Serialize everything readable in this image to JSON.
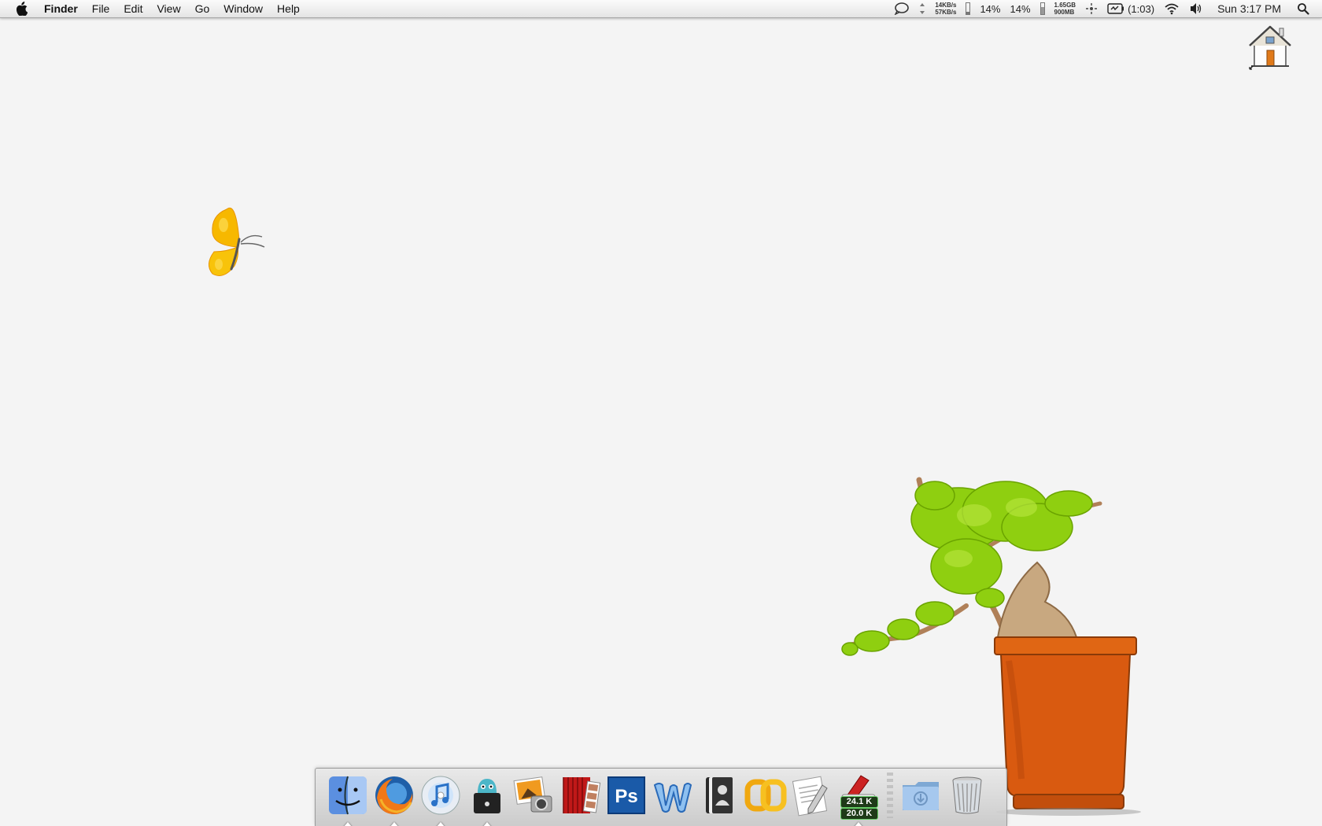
{
  "menubar": {
    "apple_icon": "apple-logo-icon",
    "app_name": "Finder",
    "menus": [
      "File",
      "Edit",
      "View",
      "Go",
      "Window",
      "Help"
    ],
    "status": {
      "net_up": "14KB/s",
      "net_down": "57KB/s",
      "cpu1": "14%",
      "cpu2": "14%",
      "disk_top": "1.65GB",
      "disk_bottom": "900MB",
      "battery_time": "(1:03)",
      "clock": "Sun 3:17 PM"
    }
  },
  "desktop": {
    "home_icon": "home-folder-icon",
    "wallpaper": {
      "butterfly_color": "#f7b800",
      "pot_color": "#d95a10",
      "leaf_color": "#8fcf10"
    }
  },
  "dock": {
    "items": [
      {
        "name": "Finder",
        "icon": "finder-icon",
        "running": true
      },
      {
        "name": "Firefox",
        "icon": "firefox-icon",
        "running": true
      },
      {
        "name": "iTunes",
        "icon": "itunes-icon",
        "running": true
      },
      {
        "name": "Monitor",
        "icon": "robot-monitor-icon",
        "running": true
      },
      {
        "name": "iPhoto",
        "icon": "iphoto-icon",
        "running": false
      },
      {
        "name": "Photo Booth",
        "icon": "photobooth-icon",
        "running": false
      },
      {
        "name": "Photoshop",
        "icon": "photoshop-icon",
        "running": false
      },
      {
        "name": "Word",
        "icon": "word-icon",
        "running": false
      },
      {
        "name": "Address Book",
        "icon": "address-book-icon",
        "running": false
      },
      {
        "name": "Links",
        "icon": "links-icon",
        "running": false
      },
      {
        "name": "TextEdit",
        "icon": "textedit-icon",
        "running": false
      },
      {
        "name": "Activity Monitor",
        "icon": "activity-monitor-icon",
        "running": true,
        "meter_top": "24.1 K",
        "meter_bottom": "20.0 K"
      },
      {
        "name": "Downloads",
        "icon": "downloads-folder-icon",
        "running": false
      },
      {
        "name": "Trash",
        "icon": "trash-icon",
        "running": false
      }
    ],
    "photoshop_label": "Ps"
  }
}
